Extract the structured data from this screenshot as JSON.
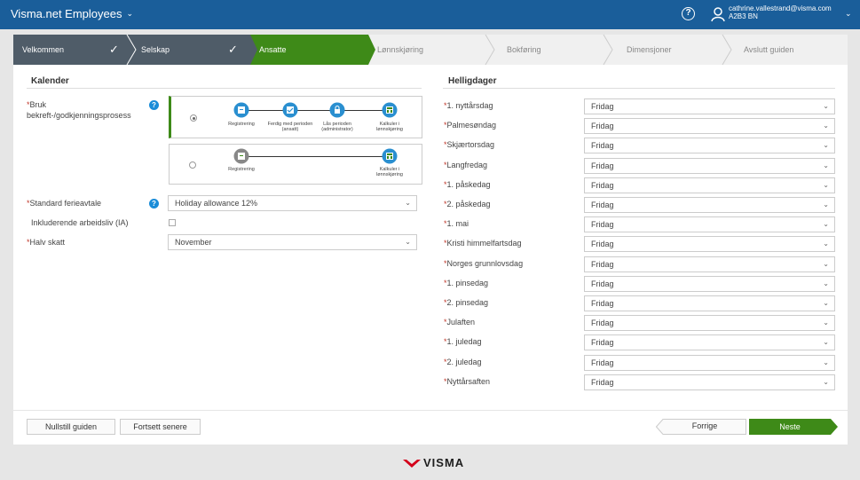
{
  "topbar": {
    "app_title": "Visma.net Employees",
    "user_email": "cathrine.vallestrand@visma.com",
    "user_company": "A2B3 BN",
    "help_symbol": "?"
  },
  "wizard_steps": [
    {
      "label": "Velkommen",
      "state": "done"
    },
    {
      "label": "Selskap",
      "state": "done"
    },
    {
      "label": "Ansatte",
      "state": "active"
    },
    {
      "label": "Lønnskjøring",
      "state": "todo"
    },
    {
      "label": "Bokføring",
      "state": "todo"
    },
    {
      "label": "Dimensjoner",
      "state": "todo"
    },
    {
      "label": "Avslutt guiden",
      "state": "todo"
    }
  ],
  "calendar": {
    "title": "Kalender",
    "approval_label_line1": "Bruk",
    "approval_label_line2": "bekreft-/godkjenningsprosess",
    "flow_option1": [
      "Registrering",
      "Ferdig med perioden (ansatt)",
      "Lås perioden (administrator)",
      "Kalkuler i lønnskjøring"
    ],
    "flow_option2": [
      "Registrering",
      "Kalkuler i lønnskjøring"
    ],
    "standard_holiday_label": "Standard ferieavtale",
    "standard_holiday_value": "Holiday allowance 12%",
    "ia_label": "Inkluderende arbeidsliv (IA)",
    "half_tax_label": "Halv skatt",
    "half_tax_value": "November"
  },
  "holidays": {
    "title": "Helligdager",
    "items": [
      {
        "name": "1. nyttårsdag",
        "value": "Fridag"
      },
      {
        "name": "Palmesøndag",
        "value": "Fridag"
      },
      {
        "name": "Skjærtorsdag",
        "value": "Fridag"
      },
      {
        "name": "Langfredag",
        "value": "Fridag"
      },
      {
        "name": "1. påskedag",
        "value": "Fridag"
      },
      {
        "name": "2. påskedag",
        "value": "Fridag"
      },
      {
        "name": "1. mai",
        "value": "Fridag"
      },
      {
        "name": "Kristi himmelfartsdag",
        "value": "Fridag"
      },
      {
        "name": "Norges grunnlovsdag",
        "value": "Fridag"
      },
      {
        "name": "1. pinsedag",
        "value": "Fridag"
      },
      {
        "name": "2. pinsedag",
        "value": "Fridag"
      },
      {
        "name": "Julaften",
        "value": "Fridag"
      },
      {
        "name": "1. juledag",
        "value": "Fridag"
      },
      {
        "name": "2. juledag",
        "value": "Fridag"
      },
      {
        "name": "Nyttårsaften",
        "value": "Fridag"
      }
    ]
  },
  "footer": {
    "reset_label": "Nullstill guiden",
    "continue_later_label": "Fortsett senere",
    "previous_label": "Forrige",
    "next_label": "Neste"
  },
  "logo_text": "VISMA",
  "colors": {
    "topbar": "#1a5e9a",
    "active_step": "#3e8a18",
    "done_step": "#4f5c68",
    "info": "#1a8cd8",
    "required": "#c0392b"
  }
}
